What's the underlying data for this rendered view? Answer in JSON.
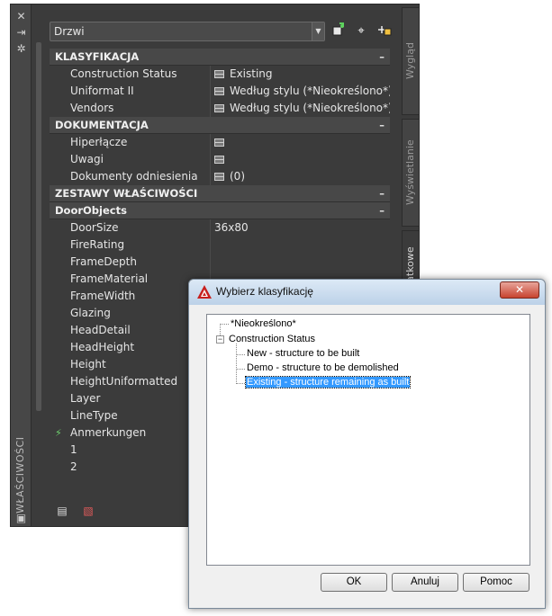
{
  "palette": {
    "title": "WŁAŚCIWOŚCI",
    "selector_value": "Drzwi",
    "tabs": [
      "Wygląd",
      "Wyświetlanie",
      "Dane dodatkowe"
    ],
    "categories": {
      "klasyfikacja": {
        "label": "KLASYFIKACJA",
        "rows": [
          {
            "name": "Construction Status",
            "value": "Existing"
          },
          {
            "name": "Uniformat II",
            "value": "Według stylu (*Nieokreślono*)"
          },
          {
            "name": "Vendors",
            "value": "Według stylu (*Nieokreślono*)"
          }
        ]
      },
      "dokumentacja": {
        "label": "DOKUMENTACJA",
        "rows": [
          {
            "name": "Hiperłącze",
            "value": ""
          },
          {
            "name": "Uwagi",
            "value": ""
          },
          {
            "name": "Dokumenty odniesienia",
            "value": "(0)"
          }
        ]
      },
      "zestawy": {
        "label": "ZESTAWY WŁAŚCIWOŚCI"
      },
      "doorobjects": {
        "label": "DoorObjects",
        "rows": [
          {
            "name": "DoorSize",
            "value": "36x80"
          },
          {
            "name": "FireRating",
            "value": ""
          },
          {
            "name": "FrameDepth",
            "value": ""
          },
          {
            "name": "FrameMaterial",
            "value": ""
          },
          {
            "name": "FrameWidth",
            "value": ""
          },
          {
            "name": "Glazing",
            "value": ""
          },
          {
            "name": "HeadDetail",
            "value": ""
          },
          {
            "name": "HeadHeight",
            "value": ""
          },
          {
            "name": "Height",
            "value": ""
          },
          {
            "name": "HeightUniformatted",
            "value": ""
          },
          {
            "name": "Layer",
            "value": ""
          },
          {
            "name": "LineType",
            "value": ""
          },
          {
            "name": "Anmerkungen",
            "value": ""
          },
          {
            "name": "1",
            "value": ""
          },
          {
            "name": "2",
            "value": ""
          }
        ]
      }
    }
  },
  "dialog": {
    "title": "Wybierz klasyfikację",
    "tree": {
      "root_unspecified": "*Nieokreślono*",
      "construction_status": "Construction Status",
      "children": [
        "New - structure to be built",
        "Demo - structure to be demolished",
        "Existing - structure remaining as built"
      ],
      "selected_index": 2
    },
    "buttons": {
      "ok": "OK",
      "cancel": "Anuluj",
      "help": "Pomoc"
    },
    "close_glyph": "✕"
  },
  "colors": {
    "palette_bg": "#3b3b3b",
    "category_bg": "#484848",
    "selection_blue": "#3399ff",
    "close_red": "#c7432f"
  },
  "icons": [
    "close-icon",
    "pin-icon",
    "settings-icon",
    "quick-select-icon",
    "pick-add-icon",
    "select-objects-icon",
    "table-icon",
    "lightning-icon",
    "autocad-logo-icon"
  ]
}
